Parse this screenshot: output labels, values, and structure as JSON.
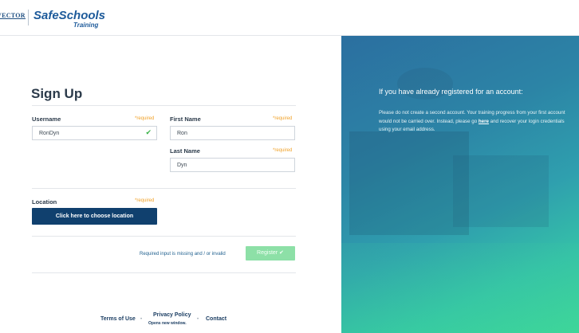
{
  "header": {
    "vector_logo": "VECTOR",
    "brand": "SafeSchools",
    "brand_sub": "Training"
  },
  "form": {
    "title": "Sign Up",
    "required_text": "*required",
    "username": {
      "label": "Username",
      "value": "RonDyn"
    },
    "first_name": {
      "label": "First Name",
      "value": "Ron"
    },
    "last_name": {
      "label": "Last Name",
      "value": "Dyn"
    },
    "location": {
      "label": "Location",
      "button_label": "Click here to choose location"
    },
    "error_message": "Required input is missing and / or invalid",
    "register_label": "Register ✔"
  },
  "footer": {
    "terms": "Terms of Use",
    "privacy": "Privacy Policy",
    "privacy_sub": "Opens new window.",
    "contact": "Contact",
    "separator": "•"
  },
  "right_panel": {
    "heading": "If you have already registered for an account:",
    "text_before": "Please do not create a second account. Your training progress from your first account would not be carried over. Instead, please go ",
    "link": "here",
    "text_after": " and recover your login credentials using your email address."
  },
  "colors": {
    "primary_button": "#10406e",
    "register_button": "#8de0a7",
    "required": "#f0a127",
    "valid_check": "#3bb44a"
  }
}
